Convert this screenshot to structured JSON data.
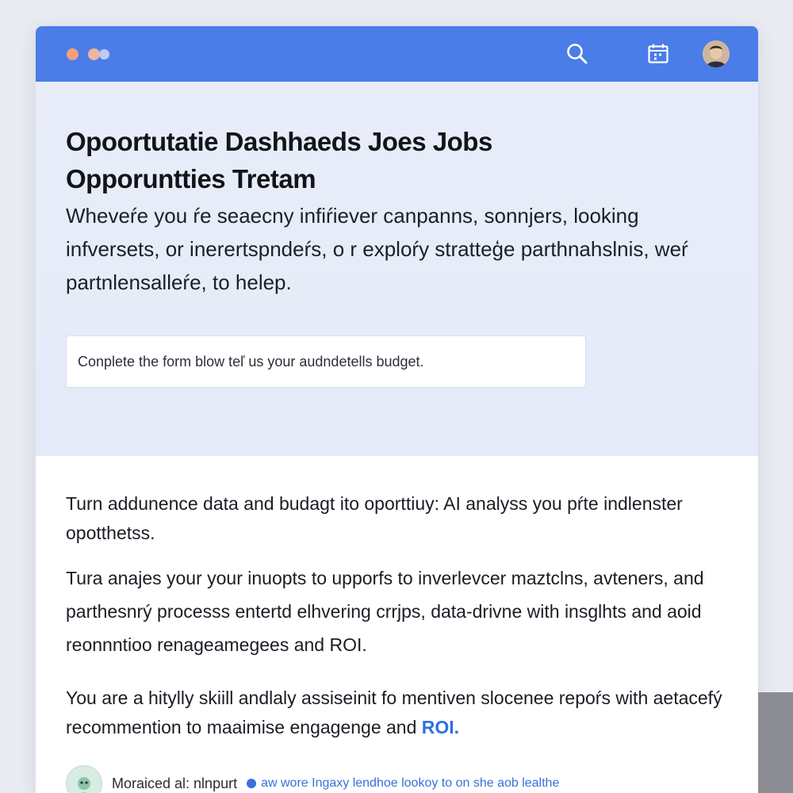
{
  "titlebar": {
    "window_controls": [
      "dot-orange",
      "dot-peach",
      "dot-blue"
    ],
    "search_icon": "search-icon",
    "calendar_icon": "calendar-icon",
    "avatar_icon": "user-avatar"
  },
  "hero": {
    "title_line_1": "Opoortutatie Dashhaeds Joes Jobs",
    "title_line_2": "Opporuntties Tretam",
    "intro": "Wheveŕe you ŕe seaecny infiŕiever canpanns, sonnjers, looking infversets, or inerertspndeŕs, o r exploŕy stratteģe parthnahslnis, weŕ partnlensalleŕe, to helep.",
    "form_placeholder": "Conplete the form blow teľ us your audndetells budget."
  },
  "content": {
    "para_1": "Turn addunence data and budagt ito oporttiuy: AI analyss you pŕte indlenster opotthetss.",
    "para_2": "Tura anajes your your inuopts to upporfs to inverlevcer maztclns, avteners, and parthesnrý processs entertd elhvering crrjps, data-drivne with insglhts and aoid reonnntioo renageamegees and ROI.",
    "para_3_text": "You are a hitylly skiill andlaly assiseinit fo mentiven slocenee repoŕs with aetacefý recommention to maaimise engagenge and",
    "para_3_badge": "ROI."
  },
  "footer": {
    "label": "Moraiced al: nlnpurt",
    "link": "aw wore Ingaxy lendhoe lookoy to on she aob lealthe"
  },
  "colors": {
    "titlebar": "#4a7de8",
    "hero_bg": "#e8edf9",
    "accent_blue": "#2f6ee6",
    "page_bg": "#e9ebf1"
  }
}
